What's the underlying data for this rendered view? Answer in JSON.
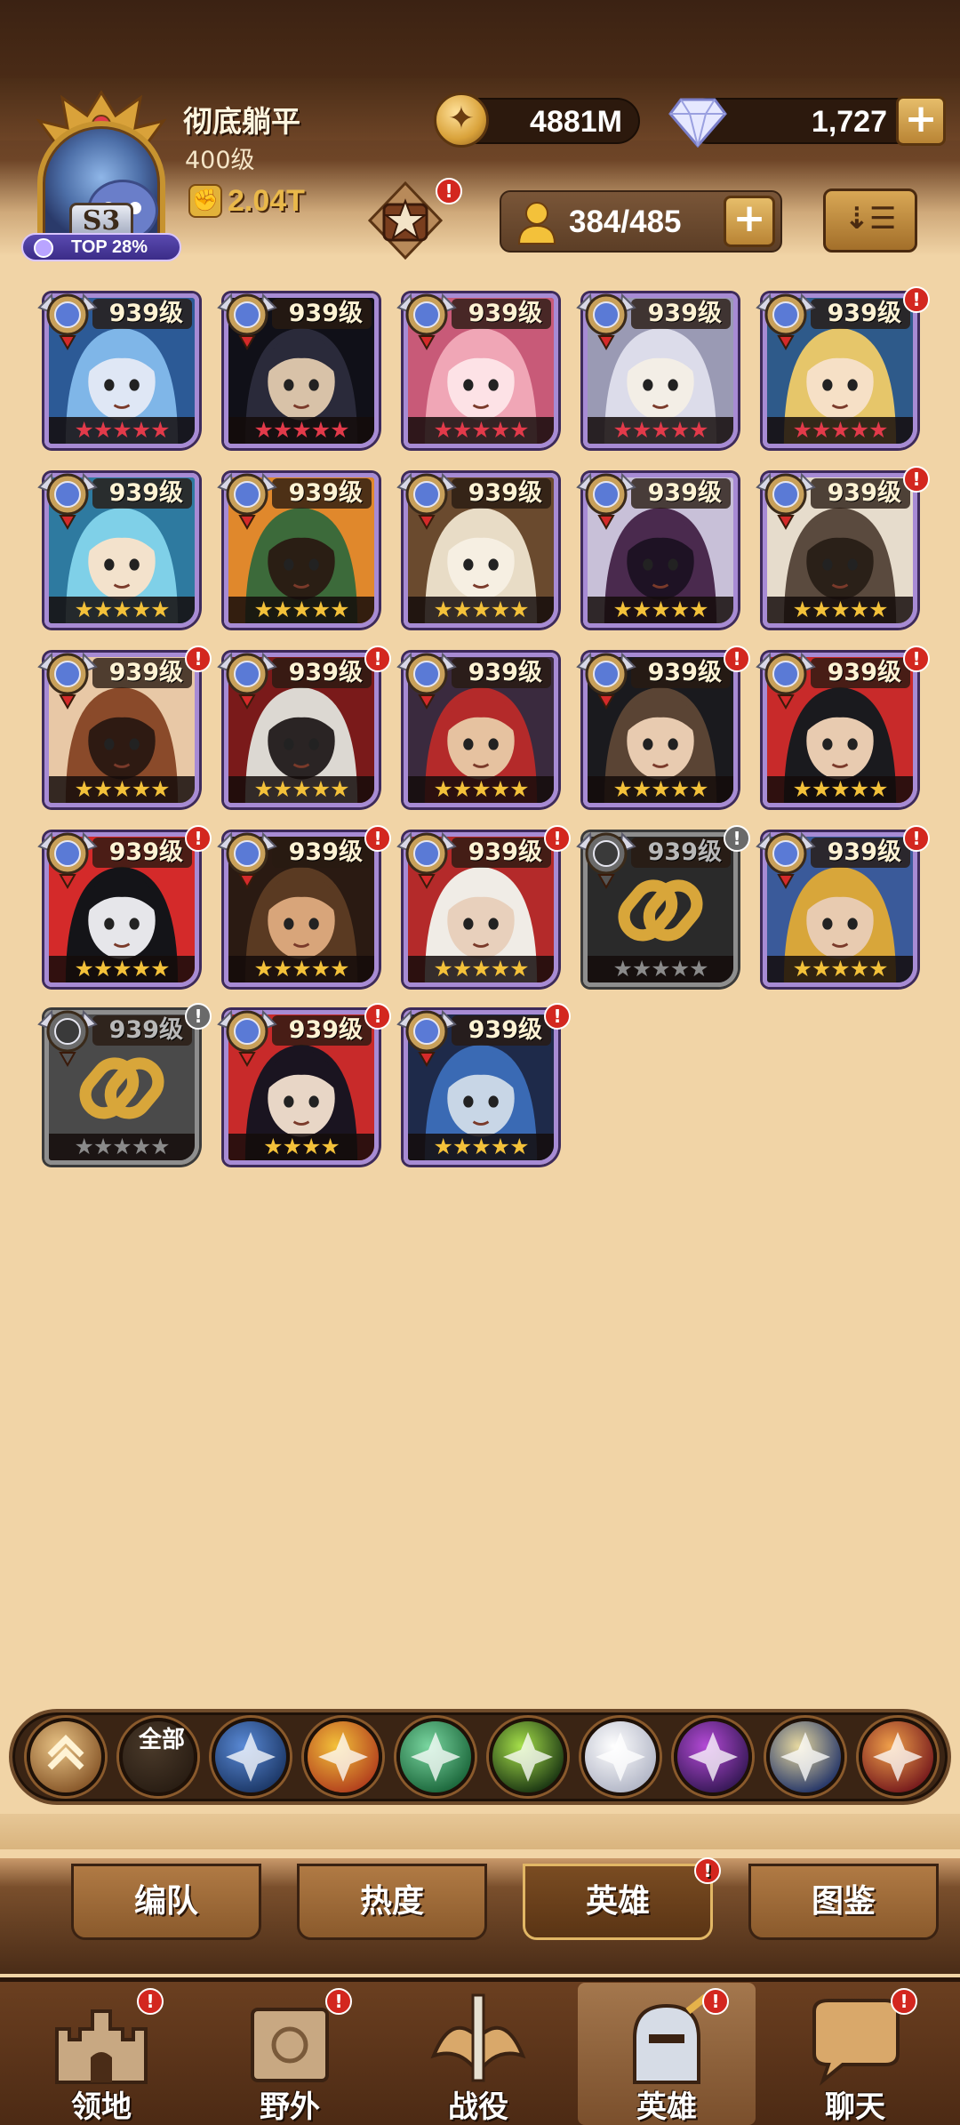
{
  "player": {
    "name": "彻底躺平",
    "level": "400级",
    "season_badge": "S3",
    "rank_text": "TOP 28%",
    "power": "2.04T"
  },
  "currency": {
    "gold": "4881M",
    "diamonds": "1,727"
  },
  "hero_count": "384/485",
  "summon_badge": "!",
  "heroes": [
    {
      "level": "939级",
      "stars": "★★★★★",
      "star_color": "red",
      "locked": false,
      "alert": false,
      "palette": [
        "#7fb6e8",
        "#2c5a96",
        "#dfe7f5"
      ],
      "icon": "hero-portrait-icon"
    },
    {
      "level": "939级",
      "stars": "★★★★★",
      "star_color": "red",
      "locked": false,
      "alert": false,
      "palette": [
        "#2a2a3a",
        "#101018",
        "#d8c2a8"
      ],
      "icon": "hero-portrait-icon"
    },
    {
      "level": "939级",
      "stars": "★★★★★",
      "star_color": "red",
      "locked": false,
      "alert": false,
      "palette": [
        "#f0a6b6",
        "#c85a78",
        "#fde2e6"
      ],
      "icon": "hero-portrait-icon"
    },
    {
      "level": "939级",
      "stars": "★★★★★",
      "star_color": "red",
      "locked": false,
      "alert": false,
      "palette": [
        "#dcdcea",
        "#9a9ab4",
        "#f3eee6"
      ],
      "icon": "hero-portrait-icon"
    },
    {
      "level": "939级",
      "stars": "★★★★★",
      "star_color": "red",
      "locked": false,
      "alert": true,
      "palette": [
        "#e6c66a",
        "#2e5a8a",
        "#f6e0c6"
      ],
      "icon": "hero-portrait-icon"
    },
    {
      "level": "939级",
      "stars": "★★★★★",
      "star_color": "gold",
      "locked": false,
      "alert": false,
      "palette": [
        "#7fd0e8",
        "#2e7aa0",
        "#f3e2cc"
      ],
      "icon": "hero-portrait-icon"
    },
    {
      "level": "939级",
      "stars": "★★★★★",
      "star_color": "gold",
      "locked": false,
      "alert": false,
      "palette": [
        "#3c6a3a",
        "#e0882c",
        "#2a1e14"
      ],
      "icon": "hero-portrait-icon"
    },
    {
      "level": "939级",
      "stars": "★★★★★",
      "star_color": "gold",
      "locked": false,
      "alert": false,
      "palette": [
        "#e8dcc6",
        "#6a4a2e",
        "#f6efe2"
      ],
      "icon": "hero-portrait-icon"
    },
    {
      "level": "939级",
      "stars": "★★★★★",
      "star_color": "gold",
      "locked": false,
      "alert": false,
      "palette": [
        "#4a2a4e",
        "#c8c0d8",
        "#1e1224"
      ],
      "icon": "hero-portrait-icon"
    },
    {
      "level": "939级",
      "stars": "★★★★★",
      "star_color": "gold",
      "locked": false,
      "alert": true,
      "palette": [
        "#5a4a3e",
        "#e6dccc",
        "#2a2018"
      ],
      "icon": "hero-portrait-icon"
    },
    {
      "level": "939级",
      "stars": "★★★★★",
      "star_color": "gold",
      "locked": false,
      "alert": true,
      "palette": [
        "#8a4a2a",
        "#e8c8a6",
        "#2e1a12"
      ],
      "icon": "hero-portrait-icon"
    },
    {
      "level": "939级",
      "stars": "★★★★★",
      "star_color": "gold",
      "locked": false,
      "alert": true,
      "palette": [
        "#dcd8d2",
        "#7a1a1a",
        "#2a2424"
      ],
      "icon": "hero-portrait-icon"
    },
    {
      "level": "939级",
      "stars": "★★★★★",
      "star_color": "gold",
      "locked": false,
      "alert": false,
      "palette": [
        "#b42a2a",
        "#3a2a3e",
        "#e6c2a0"
      ],
      "icon": "hero-portrait-icon"
    },
    {
      "level": "939级",
      "stars": "★★★★★",
      "star_color": "gold",
      "locked": false,
      "alert": true,
      "palette": [
        "#5a4434",
        "#1a1a1e",
        "#e8cbb0"
      ],
      "icon": "hero-portrait-icon"
    },
    {
      "level": "939级",
      "stars": "★★★★★",
      "star_color": "gold",
      "locked": false,
      "alert": true,
      "palette": [
        "#1a1a1e",
        "#c82a2a",
        "#e8cbb0"
      ],
      "icon": "hero-portrait-icon"
    },
    {
      "level": "939级",
      "stars": "★★★★★",
      "star_color": "gold",
      "locked": false,
      "alert": true,
      "palette": [
        "#141418",
        "#d42a2a",
        "#e6e6ea"
      ],
      "icon": "hero-portrait-icon"
    },
    {
      "level": "939级",
      "stars": "★★★★★",
      "star_color": "gold",
      "locked": false,
      "alert": true,
      "palette": [
        "#5a3a22",
        "#2a1a12",
        "#d8a57a"
      ],
      "icon": "hero-portrait-icon"
    },
    {
      "level": "939级",
      "stars": "★★★★★",
      "star_color": "gold",
      "locked": false,
      "alert": true,
      "palette": [
        "#f0ece6",
        "#b42a2a",
        "#e8d0bc"
      ],
      "icon": "hero-portrait-icon"
    },
    {
      "level": "939级",
      "stars": "★★★★★",
      "star_color": "grey",
      "locked": true,
      "alert": true,
      "palette": [
        "#2a2a2a",
        "#1a1a1a",
        "#d8a63a"
      ],
      "icon": "lock-chain-icon"
    },
    {
      "level": "939级",
      "stars": "★★★★★",
      "star_color": "gold",
      "locked": false,
      "alert": true,
      "palette": [
        "#d8a63a",
        "#3a5a9a",
        "#e8cbb0"
      ],
      "icon": "hero-portrait-icon"
    },
    {
      "level": "939级",
      "stars": "★★★★★",
      "star_color": "grey",
      "locked": true,
      "alert": true,
      "palette": [
        "#4a4a4a",
        "#2a2a2a",
        "#d8a63a"
      ],
      "icon": "lock-chain-icon"
    },
    {
      "level": "939级",
      "stars": "★★★★",
      "star_color": "gold",
      "locked": false,
      "alert": true,
      "palette": [
        "#1a1420",
        "#c82a2a",
        "#e8d6c6"
      ],
      "icon": "hero-portrait-icon"
    },
    {
      "level": "939级",
      "stars": "★★★★★",
      "star_color": "gold",
      "locked": false,
      "alert": true,
      "palette": [
        "#3a6ab4",
        "#1e2a4a",
        "#c8d6e6"
      ],
      "icon": "hero-portrait-icon"
    }
  ],
  "factions": [
    {
      "name": "chevron-up-icon",
      "label": "",
      "colors": [
        "#e9c486",
        "#8a5a2c"
      ]
    },
    {
      "name": "all-factions",
      "label": "全部",
      "colors": [
        "#4a3a2a",
        "#2a1e14"
      ]
    },
    {
      "name": "lightbearer-icon",
      "label": "",
      "colors": [
        "#5a8ad6",
        "#1e3a6a"
      ]
    },
    {
      "name": "mauler-icon",
      "label": "",
      "colors": [
        "#f3c13a",
        "#b4431e"
      ]
    },
    {
      "name": "wilder-icon",
      "label": "",
      "colors": [
        "#7ad6a0",
        "#1e6a3e"
      ]
    },
    {
      "name": "graveborn-icon",
      "label": "",
      "colors": [
        "#a6e04a",
        "#1e3a14"
      ]
    },
    {
      "name": "celestial-icon",
      "label": "",
      "colors": [
        "#ffffff",
        "#b4b8c8"
      ]
    },
    {
      "name": "hypogean-icon",
      "label": "",
      "colors": [
        "#b44ad6",
        "#3a1a5a"
      ]
    },
    {
      "name": "dimensional-icon",
      "label": "",
      "colors": [
        "#e6d8a0",
        "#2a3a6a"
      ]
    },
    {
      "name": "draconis-icon",
      "label": "",
      "colors": [
        "#f0a04a",
        "#7a1e1e"
      ]
    }
  ],
  "subtabs": [
    {
      "label": "编队",
      "active": false,
      "alert": false
    },
    {
      "label": "热度",
      "active": false,
      "alert": false
    },
    {
      "label": "英雄",
      "active": true,
      "alert": true
    },
    {
      "label": "图鉴",
      "active": false,
      "alert": false
    }
  ],
  "bottom_nav": [
    {
      "label": "领地",
      "alert": true,
      "active": false,
      "icon": "castle-icon"
    },
    {
      "label": "野外",
      "alert": true,
      "active": false,
      "icon": "map-scroll-icon"
    },
    {
      "label": "战役",
      "alert": false,
      "active": false,
      "icon": "sword-crest-icon"
    },
    {
      "label": "英雄",
      "alert": true,
      "active": true,
      "icon": "knight-helmet-icon"
    },
    {
      "label": "聊天",
      "alert": true,
      "active": false,
      "icon": "chat-bubble-icon"
    }
  ],
  "alert_glyph": "!"
}
